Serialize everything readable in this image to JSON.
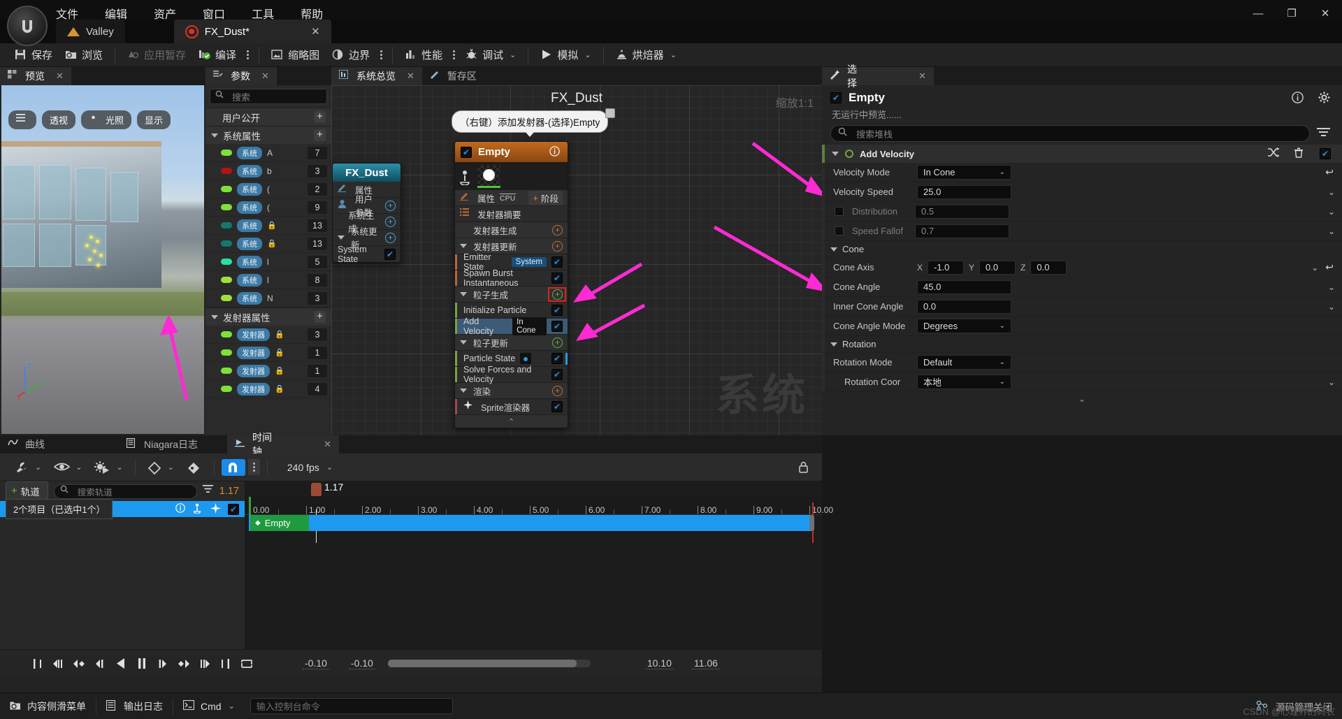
{
  "app": {
    "logo_glyph": "U"
  },
  "menu": {
    "items": [
      {
        "label": "文件"
      },
      {
        "label": "编辑"
      },
      {
        "label": "资产"
      },
      {
        "label": "窗口"
      },
      {
        "label": "工具"
      },
      {
        "label": "帮助"
      }
    ],
    "window_controls": {
      "minimize": "—",
      "maximize": "❐",
      "close": "✕"
    }
  },
  "tabs": {
    "level": {
      "label": "Valley"
    },
    "asset": {
      "label": "FX_Dust*",
      "close": "✕"
    }
  },
  "toolbar": {
    "save": "保存",
    "browse": "浏览",
    "apply_cache": "应用暂存",
    "compile": "编译",
    "thumbnail": "缩略图",
    "bounds": "边界",
    "performance": "性能",
    "debug": "调试",
    "simulate": "模拟",
    "baker": "烘焙器"
  },
  "preview": {
    "tab": "预览",
    "close": "✕",
    "buttons": [
      {
        "label": "",
        "icon": "menu-icon"
      },
      {
        "label": "透视"
      },
      {
        "label": "光照"
      },
      {
        "label": "显示"
      }
    ],
    "axis": {
      "z": "Z",
      "y": "Y",
      "x": "X"
    }
  },
  "parameters": {
    "tab": "参数",
    "close": "✕",
    "search_placeholder": "搜索",
    "groups": [
      {
        "label": "用户公开",
        "has_plus": true,
        "collapsed": true,
        "rows": []
      },
      {
        "label": "系统属性",
        "has_plus": true,
        "collapsed": false,
        "rows": [
          {
            "color": "#7fe03a",
            "tag": "系统",
            "name": "A",
            "lock": false,
            "value": "7"
          },
          {
            "color": "#b01414",
            "tag": "系统",
            "name": "b",
            "lock": false,
            "value": "3"
          },
          {
            "color": "#7fe03a",
            "tag": "系统",
            "name": "(",
            "lock": false,
            "value": "2"
          },
          {
            "color": "#7fe03a",
            "tag": "系统",
            "name": "(",
            "lock": false,
            "value": "9"
          },
          {
            "color": "#13796e",
            "tag": "系统",
            "name": "",
            "lock": true,
            "value": "13"
          },
          {
            "color": "#13796e",
            "tag": "系统",
            "name": "",
            "lock": true,
            "value": "13"
          },
          {
            "color": "#2ae0a0",
            "tag": "系统",
            "name": "l",
            "lock": false,
            "value": "5"
          },
          {
            "color": "#9ee03a",
            "tag": "系统",
            "name": "l",
            "lock": false,
            "value": "8"
          },
          {
            "color": "#9ee03a",
            "tag": "系统",
            "name": "N",
            "lock": false,
            "value": "3"
          }
        ]
      },
      {
        "label": "发射器属性",
        "has_plus": true,
        "collapsed": false,
        "rows": [
          {
            "color": "#7fe03a",
            "tag": "发射器",
            "name": "",
            "lock": true,
            "value": "3"
          },
          {
            "color": "#7fe03a",
            "tag": "发射器",
            "name": "",
            "lock": true,
            "value": "1"
          },
          {
            "color": "#7fe03a",
            "tag": "发射器",
            "name": "",
            "lock": true,
            "value": "1"
          },
          {
            "color": "#7fe03a",
            "tag": "发射器",
            "name": "",
            "lock": true,
            "value": "4"
          }
        ]
      }
    ]
  },
  "overview": {
    "tabs": [
      {
        "label": "系统总览",
        "selected": true,
        "close": "✕"
      },
      {
        "label": "暂存区",
        "selected": false
      }
    ],
    "graph_title": "FX_Dust",
    "zoom_label": "缩放1:1",
    "watermark": "系统",
    "tooltip": "（右键）添加发射器-(选择)Empty",
    "system_node": {
      "title": "FX_Dust",
      "rows": [
        {
          "label": "属性",
          "icon": "pencil-icon",
          "plus": false
        },
        {
          "label": "用户参数",
          "icon": "user-icon",
          "plus": true
        },
        {
          "label": "系统生成",
          "icon": "",
          "plus": true
        },
        {
          "label": "系统更新",
          "icon": "",
          "plus": true,
          "tri": true
        },
        {
          "label": "System State",
          "icon": "",
          "checkbox": true
        }
      ]
    },
    "emitter_node": {
      "title": "Empty",
      "checked": true,
      "info_icon": "info-icon",
      "props_label": "属性",
      "cpu_label": "CPU",
      "stage_label": "阶段",
      "summary_label": "发射器摘要",
      "sections": [
        {
          "type": "section",
          "label": "发射器生成",
          "plus": "orange",
          "tri": false
        },
        {
          "type": "section",
          "label": "发射器更新",
          "plus": "orange",
          "tri": true
        },
        {
          "type": "module",
          "label": "Emitter State",
          "pill": "System",
          "checked": true,
          "bar": "#b5683a"
        },
        {
          "type": "module",
          "label": "Spawn Burst Instantaneous",
          "checked": true,
          "bar": "#b5683a"
        },
        {
          "type": "section",
          "label": "粒子生成",
          "plus": "green",
          "tri": true,
          "highlight": true
        },
        {
          "type": "module",
          "label": "Initialize Particle",
          "checked": true,
          "bar": "#7aa33f"
        },
        {
          "type": "module",
          "label": "Add Velocity",
          "pill_dark": "In Cone",
          "checked": true,
          "selected": true,
          "bar": "#7aa33f"
        },
        {
          "type": "section",
          "label": "粒子更新",
          "plus": "green",
          "tri": true
        },
        {
          "type": "module",
          "label": "Particle State",
          "dot": true,
          "checked": true,
          "bar": "#7aa33f"
        },
        {
          "type": "module",
          "label": "Solve Forces and Velocity",
          "checked": true,
          "bar": "#7aa33f"
        },
        {
          "type": "section",
          "label": "渲染",
          "plus": "orange",
          "tri": true
        },
        {
          "type": "module",
          "label": "Sprite渲染器",
          "icon": "star-icon",
          "checked": true,
          "bar": "#a04a52"
        }
      ]
    }
  },
  "selection": {
    "tab": "选择",
    "close": "✕",
    "title": "Empty",
    "subtitle": "无运行中预览......",
    "search_placeholder": "搜索堆栈",
    "module": {
      "name": "Add Velocity",
      "enabled": true
    },
    "properties": [
      {
        "kind": "row",
        "label": "Velocity Mode",
        "control": "dropdown",
        "value": "In Cone",
        "revert": true
      },
      {
        "kind": "row",
        "label": "Velocity Speed",
        "control": "field",
        "value": "25.0",
        "caret": true
      },
      {
        "kind": "row",
        "label": "Distribution",
        "control": "field",
        "value": "0.5",
        "dim": true,
        "checkbox": true,
        "caret": true
      },
      {
        "kind": "row",
        "label": "Speed Fallof",
        "control": "field",
        "value": "0.7",
        "dim": true,
        "checkbox": true,
        "caret": true
      },
      {
        "kind": "cat",
        "label": "Cone"
      },
      {
        "kind": "vec",
        "label": "Cone Axis",
        "x": "-1.0",
        "y": "0.0",
        "z": "0.0",
        "caret": true,
        "revert": true
      },
      {
        "kind": "row",
        "label": "Cone Angle",
        "control": "field",
        "value": "45.0",
        "caret": true
      },
      {
        "kind": "row",
        "label": "Inner Cone Angle",
        "control": "field",
        "value": "0.0",
        "caret": true
      },
      {
        "kind": "row",
        "label": "Cone Angle Mode",
        "control": "dropdown",
        "value": "Degrees"
      },
      {
        "kind": "cat",
        "label": "Rotation"
      },
      {
        "kind": "row",
        "label": "Rotation Mode",
        "control": "dropdown",
        "value": "Default"
      },
      {
        "kind": "row",
        "label": "Rotation Coor",
        "control": "dropdown",
        "value": "本地",
        "indent": true,
        "caret": true
      }
    ],
    "axis_labels": {
      "x": "X",
      "y": "Y",
      "z": "Z"
    }
  },
  "bottom": {
    "tabs": [
      {
        "label": "曲线",
        "selected": false
      },
      {
        "label": "Niagara日志",
        "selected": false
      },
      {
        "label": "时间轴",
        "selected": true,
        "close": "✕"
      }
    ],
    "fps": "240 fps",
    "add_track": "轨道",
    "track_search_placeholder": "搜索轨道",
    "current_time": "1.17",
    "track_name": "Empty",
    "clip_name": "Empty",
    "selection_tooltip": "2个项目（已选中1个）",
    "playhead_value": "1.17",
    "ruler_labels": [
      "0.00",
      "1.00",
      "2.00",
      "3.00",
      "4.00",
      "5.00",
      "6.00",
      "7.00",
      "8.00",
      "9.00",
      "10.00"
    ],
    "range_start": "-0.10",
    "range_in": "-0.10",
    "range_out": "10.10",
    "range_end": "11.06"
  },
  "statusbar": {
    "content_drawer": "内容侧滑菜单",
    "output_log": "输出日志",
    "cmd": "Cmd",
    "cmd_placeholder": "输入控制台命令",
    "source_control": "源码管理关闭",
    "watermark": "CSDN @心理界的码农"
  }
}
